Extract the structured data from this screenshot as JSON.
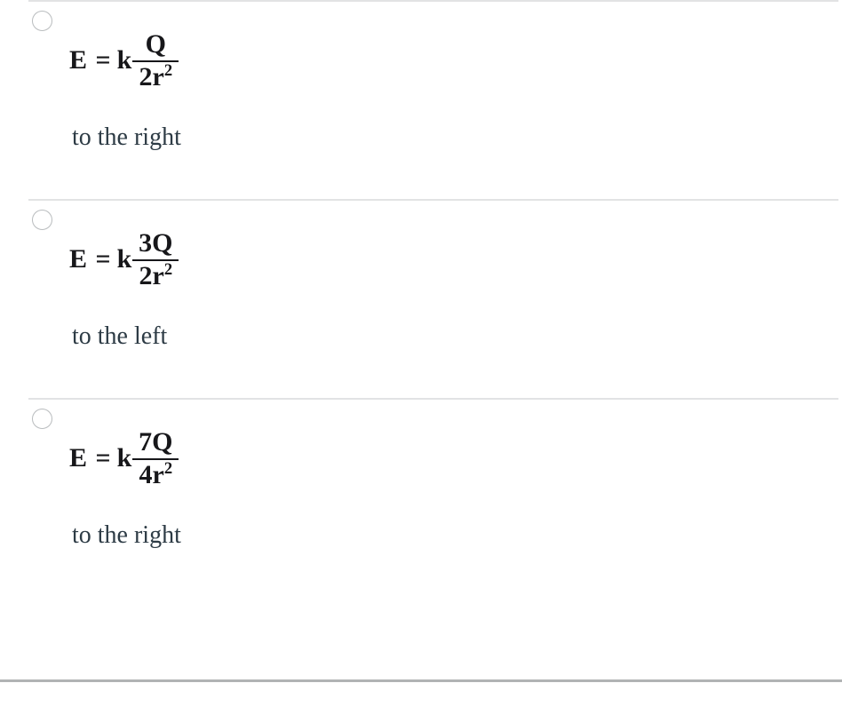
{
  "page": {
    "background_color": "#ffffff",
    "text_color": "#2d3b45",
    "math_color": "#17171a",
    "divider_color": "#e2e3e4",
    "bottom_rule_color": "#b1b3b4",
    "radio_border_color": "#b9bcbe"
  },
  "answers": [
    {
      "id": "answer-a",
      "selected": false,
      "formula": {
        "lhs": "E",
        "equals": "=",
        "coefficient": "k",
        "numerator": "Q",
        "denominator_base": "2r",
        "denominator_exponent": "2",
        "plain_text": "E = k Q/(2r^2)"
      },
      "direction": "to the right"
    },
    {
      "id": "answer-b",
      "selected": false,
      "formula": {
        "lhs": "E",
        "equals": "=",
        "coefficient": "k",
        "numerator": "3Q",
        "denominator_base": "2r",
        "denominator_exponent": "2",
        "plain_text": "E = k 3Q/(2r^2)"
      },
      "direction": "to the left"
    },
    {
      "id": "answer-c",
      "selected": false,
      "formula": {
        "lhs": "E",
        "equals": "=",
        "coefficient": "k",
        "numerator": "7Q",
        "denominator_base": "4r",
        "denominator_exponent": "2",
        "plain_text": "E = k 7Q/(4r^2)"
      },
      "direction": "to the right"
    }
  ]
}
